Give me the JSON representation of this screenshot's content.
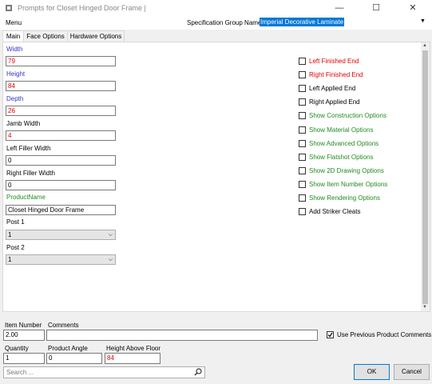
{
  "window": {
    "title": "Prompts for Closet Hinged Door Frame |",
    "minimize": "—",
    "maximize": "☐",
    "close": "✕"
  },
  "menubar": {
    "menu_label": "Menu",
    "spec_group_label": "Specification Group Name",
    "spec_group_value": "Imperial Decorative Laminate"
  },
  "tabs": [
    {
      "label": "Main",
      "active": true
    },
    {
      "label": "Face Options",
      "active": false
    },
    {
      "label": "Hardware Options",
      "active": false
    }
  ],
  "fields": {
    "width": {
      "label": "Width",
      "value": "79"
    },
    "height": {
      "label": "Height",
      "value": "84"
    },
    "depth": {
      "label": "Depth",
      "value": "26"
    },
    "jamb_width": {
      "label": "Jamb Width",
      "value": "4"
    },
    "left_filler": {
      "label": "Left Filler Width",
      "value": "0"
    },
    "right_filler": {
      "label": "Right Filler Width",
      "value": "0"
    },
    "product_name": {
      "label": "ProductName",
      "value": "Closet Hinged Door Frame"
    },
    "post1": {
      "label": "Post 1",
      "value": "1"
    },
    "post2": {
      "label": "Post 2",
      "value": "1"
    }
  },
  "checkboxes": [
    {
      "label": "Left Finished End",
      "checked": false,
      "color": "#e00000"
    },
    {
      "label": "Right Finished End",
      "checked": false,
      "color": "#e00000"
    },
    {
      "label": "Left Applied End",
      "checked": false,
      "color": "#000000"
    },
    {
      "label": "Right Applied End",
      "checked": false,
      "color": "#000000"
    },
    {
      "label": "Show Construction Options",
      "checked": false,
      "color": "#228b22"
    },
    {
      "label": "Show Material Options",
      "checked": false,
      "color": "#228b22"
    },
    {
      "label": "Show Advanced Options",
      "checked": false,
      "color": "#228b22"
    },
    {
      "label": "Show Flatshot Options",
      "checked": false,
      "color": "#228b22"
    },
    {
      "label": "Show 2D Drawing Options",
      "checked": false,
      "color": "#228b22"
    },
    {
      "label": "Show Item Number Options",
      "checked": false,
      "color": "#228b22"
    },
    {
      "label": "Show Rendering Options",
      "checked": false,
      "color": "#228b22"
    },
    {
      "label": "Add Striker Cleats",
      "checked": false,
      "color": "#000000"
    }
  ],
  "bottom": {
    "item_number_label": "Item Number",
    "item_number_value": "2.00",
    "comments_label": "Comments",
    "comments_value": "",
    "use_prev_label": "Use Previous Product Comments",
    "use_prev_checked": true,
    "quantity_label": "Quantity",
    "quantity_value": "1",
    "product_angle_label": "Product Angle",
    "product_angle_value": "0",
    "height_above_floor_label": "Height Above Floor",
    "height_above_floor_value": "84",
    "search_placeholder": "Search ...",
    "ok_label": "OK",
    "cancel_label": "Cancel"
  },
  "colors": {
    "accent": "#0078d7",
    "label_blue": "#3333cc",
    "value_red": "#e00000",
    "label_green": "#228b22"
  }
}
